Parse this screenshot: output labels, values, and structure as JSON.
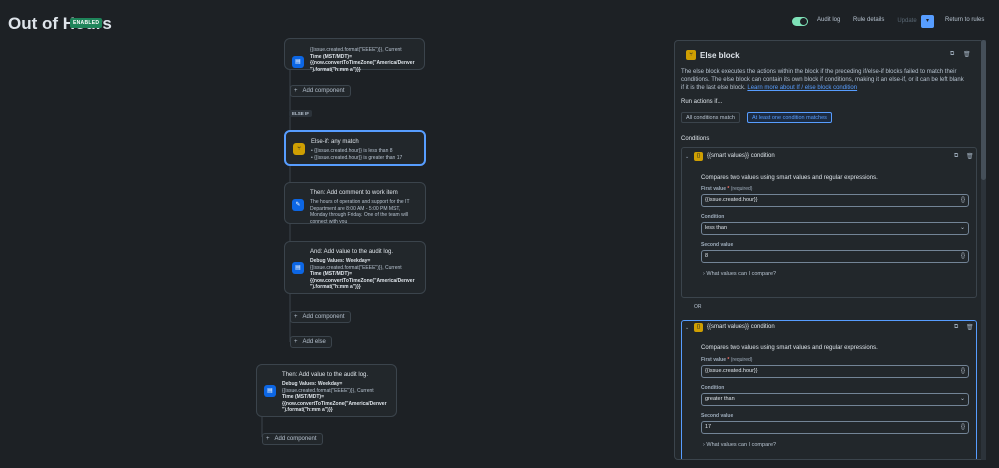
{
  "header": {
    "title": "Out of Hours",
    "status_badge": "ENABLED",
    "audit_log": "Audit log",
    "rule_details": "Rule details",
    "update": "Update",
    "return": "Return to rules"
  },
  "canvas": {
    "top_card": {
      "line1": "{{issue.created.format(\"EEEE\")}}, Current",
      "line2": "Time (MST/MDT)=",
      "line3": "{{now.convertToTimeZone(\"America/Denver",
      "line4": "\").format(\"h:mm a\")}}"
    },
    "add_component": "Add component",
    "else_if_tag": "ELSE IF",
    "else_if_card": {
      "title": "Else-if: any match",
      "cond1": "{{issue.created.hour}} is less than 8",
      "cond2": "{{issue.created.hour}} is greater than 17"
    },
    "comment_card": {
      "title": "Then: Add comment to work item",
      "body": "The hours of operation and support for the IT Department are 8:00 AM - 5:00 PM MST, Monday through Friday. One of the team will connect with you"
    },
    "audit_card": {
      "title": "And: Add value to the audit log.",
      "l1": "Debug Values: Weekday=",
      "l2": "{{issue.created.format(\"EEEE\")}}, Current",
      "l3": "Time (MST/MDT)=",
      "l4": "{{now.convertToTimeZone(\"America/Denver",
      "l5": "\").format(\"h:mm a\")}}"
    },
    "add_else": "Add else",
    "final_card": {
      "title": "Then: Add value to the audit log.",
      "l1": "Debug Values: Weekday=",
      "l2": "{{issue.created.format(\"EEEE\")}}, Current",
      "l3": "Time (MST/MDT)=",
      "l4": "{{now.convertToTimeZone(\"America/Denver",
      "l5": "\").format(\"h:mm a\")}}"
    }
  },
  "panel": {
    "title": "Else block",
    "description": "The else block executes the actions within the block if the preceding if/else-if blocks failed to match their conditions. The else block can contain its own block if conditions, making it an else-if, or it can be left blank if it is the last else block.",
    "learn_more": "Learn more about If / else block condition",
    "run_actions": "Run actions if...",
    "opt_all": "All conditions match",
    "opt_any": "At least one condition matches",
    "conditions_label": "Conditions",
    "or_label": "OR",
    "conditions": [
      {
        "title": "{{smart values}} condition",
        "compare_text": "Compares two values using smart values and regular expressions.",
        "first_label": "First value",
        "required": "(required)",
        "first_value": "{{issue.created.hour}}",
        "condition_label": "Condition",
        "condition_value": "less than",
        "second_label": "Second value",
        "second_value": "8",
        "what_values": "What values can I compare?"
      },
      {
        "title": "{{smart values}} condition",
        "compare_text": "Compares two values using smart values and regular expressions.",
        "first_label": "First value",
        "required": "(required)",
        "first_value": "{{issue.created.hour}}",
        "condition_label": "Condition",
        "condition_value": "greater than",
        "second_label": "Second value",
        "second_value": "17",
        "what_values": "What values can I compare?"
      }
    ]
  },
  "colors": {
    "background": "#1d2125",
    "accent": "#579dff",
    "enabled_badge": "#1f845a",
    "branch_icon": "#cf9f02",
    "action_icon": "#0c66e4"
  }
}
